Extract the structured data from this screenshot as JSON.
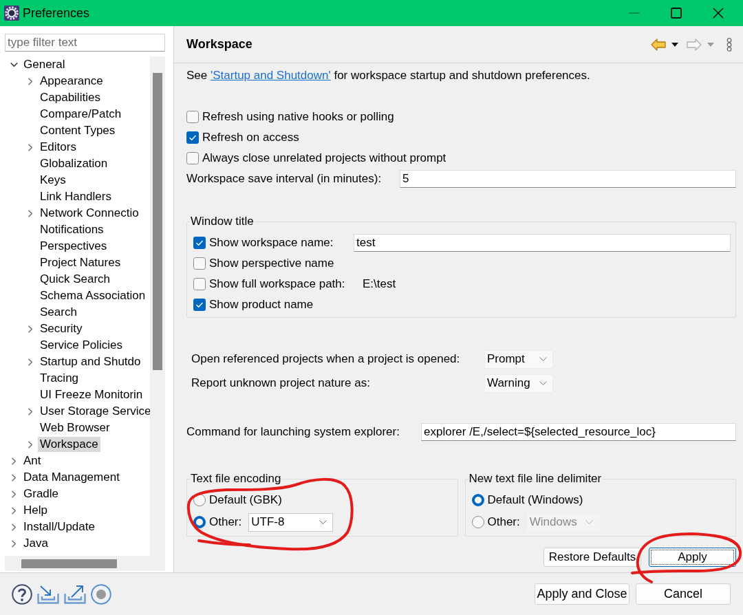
{
  "window": {
    "title": "Preferences",
    "minimize_enabled": false
  },
  "sidebar": {
    "filter": {
      "placeholder": "type filter text"
    },
    "tree": [
      {
        "label": "General",
        "kind": "branch",
        "expanded": true,
        "selected": false,
        "children": [
          {
            "label": "Appearance",
            "kind": "branch",
            "expanded": false,
            "selected": false
          },
          {
            "label": "Capabilities",
            "kind": "leaf",
            "selected": false
          },
          {
            "label": "Compare/Patch",
            "kind": "leaf",
            "selected": false
          },
          {
            "label": "Content Types",
            "kind": "leaf",
            "selected": false
          },
          {
            "label": "Editors",
            "kind": "branch",
            "expanded": false,
            "selected": false
          },
          {
            "label": "Globalization",
            "kind": "leaf",
            "selected": false
          },
          {
            "label": "Keys",
            "kind": "leaf",
            "selected": false
          },
          {
            "label": "Link Handlers",
            "kind": "leaf",
            "selected": false
          },
          {
            "label": "Network Connectio",
            "kind": "branch",
            "expanded": false,
            "selected": false
          },
          {
            "label": "Notifications",
            "kind": "leaf",
            "selected": false
          },
          {
            "label": "Perspectives",
            "kind": "leaf",
            "selected": false
          },
          {
            "label": "Project Natures",
            "kind": "leaf",
            "selected": false
          },
          {
            "label": "Quick Search",
            "kind": "leaf",
            "selected": false
          },
          {
            "label": "Schema Association",
            "kind": "leaf",
            "selected": false
          },
          {
            "label": "Search",
            "kind": "leaf",
            "selected": false
          },
          {
            "label": "Security",
            "kind": "branch",
            "expanded": false,
            "selected": false
          },
          {
            "label": "Service Policies",
            "kind": "leaf",
            "selected": false
          },
          {
            "label": "Startup and Shutdo",
            "kind": "branch",
            "expanded": false,
            "selected": false
          },
          {
            "label": "Tracing",
            "kind": "leaf",
            "selected": false
          },
          {
            "label": "UI Freeze Monitorin",
            "kind": "leaf",
            "selected": false
          },
          {
            "label": "User Storage Service",
            "kind": "branch",
            "expanded": false,
            "selected": false
          },
          {
            "label": "Web Browser",
            "kind": "leaf",
            "selected": false
          },
          {
            "label": "Workspace",
            "kind": "branch",
            "expanded": false,
            "selected": true
          }
        ]
      },
      {
        "label": "Ant",
        "kind": "branch",
        "expanded": false,
        "selected": false
      },
      {
        "label": "Data Management",
        "kind": "branch",
        "expanded": false,
        "selected": false
      },
      {
        "label": "Gradle",
        "kind": "branch",
        "expanded": false,
        "selected": false
      },
      {
        "label": "Help",
        "kind": "branch",
        "expanded": false,
        "selected": false
      },
      {
        "label": "Install/Update",
        "kind": "branch",
        "expanded": false,
        "selected": false
      },
      {
        "label": "Java",
        "kind": "branch",
        "expanded": false,
        "selected": false
      }
    ]
  },
  "main": {
    "title": "Workspace",
    "nav": {
      "back_enabled": true,
      "forward_enabled": false
    },
    "intro": {
      "before": "See ",
      "link": "'Startup and Shutdown'",
      "after": " for workspace startup and shutdown preferences."
    },
    "options": [
      {
        "label": "Refresh using native hooks or polling",
        "checked": false
      },
      {
        "label": "Refresh on access",
        "checked": true
      },
      {
        "label": "Always close unrelated projects without prompt",
        "checked": false
      }
    ],
    "save_interval": {
      "label": "Workspace save interval (in minutes):",
      "value": "5"
    },
    "window_title": {
      "legend": "Window title",
      "items": [
        {
          "kind": "field",
          "label": "Show workspace name:",
          "checked": true,
          "value": "test"
        },
        {
          "kind": "plain",
          "label": "Show perspective name",
          "checked": false
        },
        {
          "kind": "text",
          "label": "Show full workspace path:",
          "checked": false,
          "text": "E:\\test"
        },
        {
          "kind": "plain",
          "label": "Show product name",
          "checked": true
        }
      ]
    },
    "dropdowns": [
      {
        "label": "Open referenced projects when a project is opened:",
        "value": "Prompt"
      },
      {
        "label": "Report unknown project nature as:",
        "value": "Warning"
      }
    ],
    "explorer_command": {
      "label": "Command for launching system explorer:",
      "value": "explorer /E,/select=${selected_resource_loc}"
    },
    "groups": [
      {
        "legend": "Text file encoding",
        "circled": true,
        "options": [
          {
            "label": "Default (GBK)",
            "selected": false
          },
          {
            "label": "Other:",
            "selected": true,
            "value": "UTF-8"
          }
        ]
      },
      {
        "legend": "New text file line delimiter",
        "circled": false,
        "options": [
          {
            "label": "Default (Windows)",
            "selected": true
          },
          {
            "label": "Other:",
            "selected": false,
            "value": "Windows"
          }
        ]
      }
    ],
    "buttons": [
      {
        "label": "Restore Defaults",
        "focused": false,
        "circled": false
      },
      {
        "label": "Apply",
        "focused": true,
        "circled": true
      }
    ]
  },
  "footer": {
    "buttons": [
      {
        "label": "Apply and Close"
      },
      {
        "label": "Cancel"
      }
    ]
  }
}
